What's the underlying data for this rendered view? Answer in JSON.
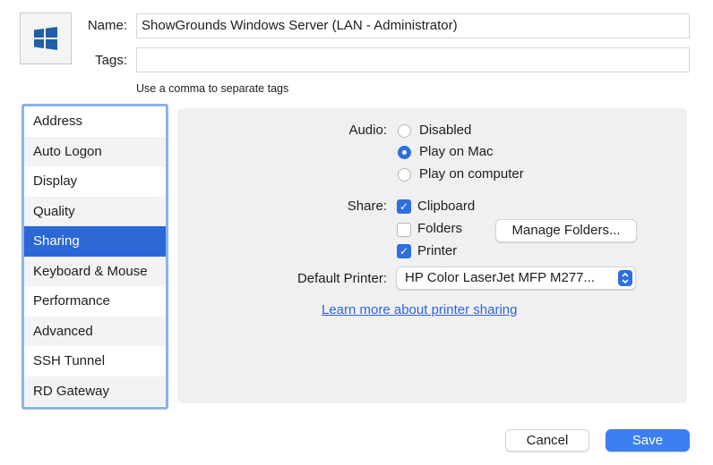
{
  "header": {
    "os_icon": "windows-logo-icon",
    "name_label": "Name:",
    "name_value": "ShowGrounds Windows Server (LAN - Administrator)",
    "tags_label": "Tags:",
    "tags_value": "",
    "tags_hint": "Use a comma to separate tags"
  },
  "sidebar": {
    "items": [
      {
        "label": "Address"
      },
      {
        "label": "Auto Logon"
      },
      {
        "label": "Display"
      },
      {
        "label": "Quality"
      },
      {
        "label": "Sharing",
        "selected": true
      },
      {
        "label": "Keyboard & Mouse"
      },
      {
        "label": "Performance"
      },
      {
        "label": "Advanced"
      },
      {
        "label": "SSH Tunnel"
      },
      {
        "label": "RD Gateway"
      }
    ]
  },
  "sharing": {
    "audio_label": "Audio:",
    "audio_options": [
      {
        "label": "Disabled",
        "selected": false
      },
      {
        "label": "Play on Mac",
        "selected": true
      },
      {
        "label": "Play on computer",
        "selected": false
      }
    ],
    "share_label": "Share:",
    "share_options": [
      {
        "label": "Clipboard",
        "checked": true
      },
      {
        "label": "Folders",
        "checked": false
      },
      {
        "label": "Printer",
        "checked": true
      }
    ],
    "manage_folders_label": "Manage Folders...",
    "default_printer_label": "Default Printer:",
    "default_printer_value": "HP Color LaserJet MFP M277...",
    "learn_more_link": "Learn more about printer sharing"
  },
  "footer": {
    "cancel_label": "Cancel",
    "save_label": "Save"
  },
  "colors": {
    "accent": "#2d6fe0",
    "sidebar_selected": "#2d67d5",
    "sidebar_border": "#8ab2f3",
    "link": "#2b66d6"
  }
}
